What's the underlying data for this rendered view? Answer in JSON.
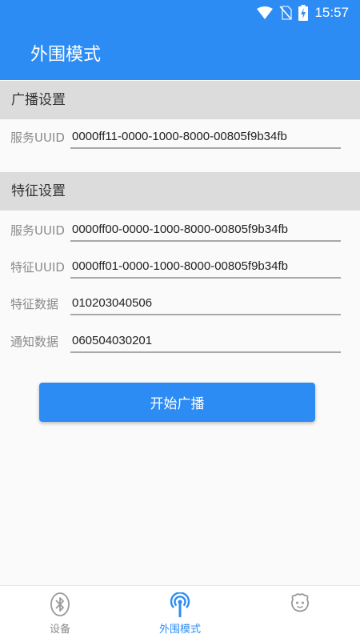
{
  "status_bar": {
    "time": "15:57"
  },
  "app_bar": {
    "title": "外围模式"
  },
  "broadcast_section": {
    "header": "广播设置",
    "service_uuid_label": "服务UUID",
    "service_uuid_value": "0000ff11-0000-1000-8000-00805f9b34fb"
  },
  "feature_section": {
    "header": "特征设置",
    "service_uuid_label": "服务UUID",
    "service_uuid_value": "0000ff00-0000-1000-8000-00805f9b34fb",
    "char_uuid_label": "特征UUID",
    "char_uuid_value": "0000ff01-0000-1000-8000-00805f9b34fb",
    "char_data_label": "特征数据",
    "char_data_value": "010203040506",
    "notify_data_label": "通知数据",
    "notify_data_value": "060504030201"
  },
  "start_button_label": "开始广播",
  "bottom_nav": {
    "items": [
      {
        "label": "设备",
        "icon": "bluetooth-icon",
        "active": false
      },
      {
        "label": "外围模式",
        "icon": "broadcast-tower-icon",
        "active": true
      },
      {
        "label": "",
        "icon": "face-icon",
        "active": false
      }
    ]
  },
  "colors": {
    "primary": "#2c8cf4",
    "section_bg": "#dcdcdc",
    "label": "#8a8a8a"
  }
}
